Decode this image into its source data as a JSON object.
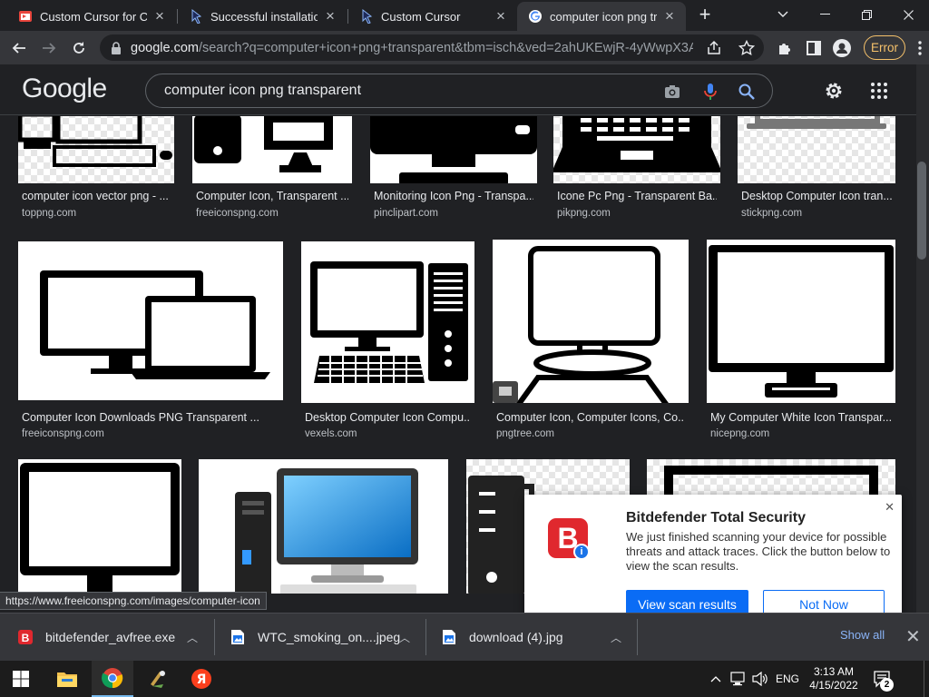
{
  "tabs": [
    {
      "title": "Custom Cursor for Chrome",
      "icon": "custom-cursor-favicon"
    },
    {
      "title": "Successful installation - Custom Cursor",
      "icon": "custom-cursor-favicon"
    },
    {
      "title": "Custom Cursor",
      "icon": "custom-cursor-favicon"
    },
    {
      "title": "computer icon png transparent - Google Search",
      "icon": "google-favicon",
      "active": true
    }
  ],
  "address": {
    "host": "google.com",
    "path": "/search?q=computer+icon+png+transparent&tbm=isch&ved=2ahUKEwjR-4yWwpX3Ah..."
  },
  "profile_error_label": "Error",
  "google": {
    "logo": "Google",
    "query": "computer icon png transparent"
  },
  "results": [
    {
      "title": "computer icon vector png - ...",
      "source": "toppng.com"
    },
    {
      "title": "Computer Icon, Transparent ...",
      "source": "freeiconspng.com"
    },
    {
      "title": "Monitoring Icon Png - Transpa...",
      "source": "pinclipart.com"
    },
    {
      "title": "Icone Pc Png - Transparent Ba...",
      "source": "pikpng.com"
    },
    {
      "title": "Desktop Computer Icon tran...",
      "source": "stickpng.com"
    },
    {
      "title": "Computer Icon Downloads PNG Transparent ...",
      "source": "freeiconspng.com"
    },
    {
      "title": "Desktop Computer Icon Compu...",
      "source": "vexels.com"
    },
    {
      "title": "Computer Icon, Computer Icons, Co...",
      "source": "pngtree.com"
    },
    {
      "title": "My Computer White Icon Transpar...",
      "source": "nicepng.com"
    },
    {
      "title": "",
      "source": ""
    },
    {
      "title": "",
      "source": ""
    },
    {
      "title": "",
      "source": ""
    },
    {
      "title": "",
      "source": ""
    }
  ],
  "status_url": "https://www.freeiconspng.com/images/computer-icon",
  "popup": {
    "title": "Bitdefender Total Security",
    "body": "We just finished scanning your device for possible threats and attack traces. Click the button below to view the scan results.",
    "primary": "View scan results",
    "secondary": "Not Now",
    "logo_letter": "B",
    "badge": "i",
    "brand_color": "#e0282e",
    "button_color": "#0a6cf5"
  },
  "downloads": [
    {
      "name": "bitdefender_avfree.exe",
      "icon": "bitdefender-file-icon"
    },
    {
      "name": "WTC_smoking_on....jpeg",
      "icon": "image-file-icon"
    },
    {
      "name": "download (4).jpg",
      "icon": "image-file-icon"
    }
  ],
  "downloads_show_all": "Show all",
  "taskbar": {
    "apps": [
      "start",
      "file-explorer",
      "chrome",
      "image-app",
      "yandex"
    ],
    "yandex_letter": "Я",
    "lang": "ENG",
    "time": "3:13 AM",
    "date": "4/15/2022",
    "notification_count": "2"
  }
}
